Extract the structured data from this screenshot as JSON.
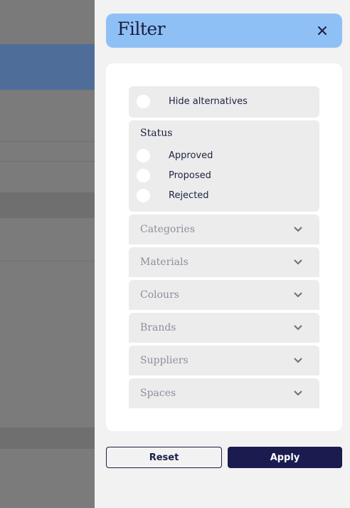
{
  "colors": {
    "header_bg": "#8fc0f5",
    "accent_dark": "#1a1c4f",
    "overlay": "#7b7b7b",
    "highlight_row": "#4e6e99"
  },
  "filter": {
    "title": "Filter",
    "close_icon": "close-icon",
    "hide_alternatives": {
      "label": "Hide alternatives",
      "checked": false
    },
    "status": {
      "title": "Status",
      "options": [
        {
          "label": "Approved",
          "checked": false
        },
        {
          "label": "Proposed",
          "checked": false
        },
        {
          "label": "Rejected",
          "checked": false
        }
      ]
    },
    "sections": [
      {
        "label": "Categories",
        "icon": "chevron-down-icon"
      },
      {
        "label": "Materials",
        "icon": "chevron-down-icon"
      },
      {
        "label": "Colours",
        "icon": "chevron-down-icon"
      },
      {
        "label": "Brands",
        "icon": "chevron-down-icon"
      },
      {
        "label": "Suppliers",
        "icon": "chevron-down-icon"
      },
      {
        "label": "Spaces",
        "icon": "chevron-down-icon"
      }
    ],
    "actions": {
      "reset_label": "Reset",
      "apply_label": "Apply"
    }
  }
}
